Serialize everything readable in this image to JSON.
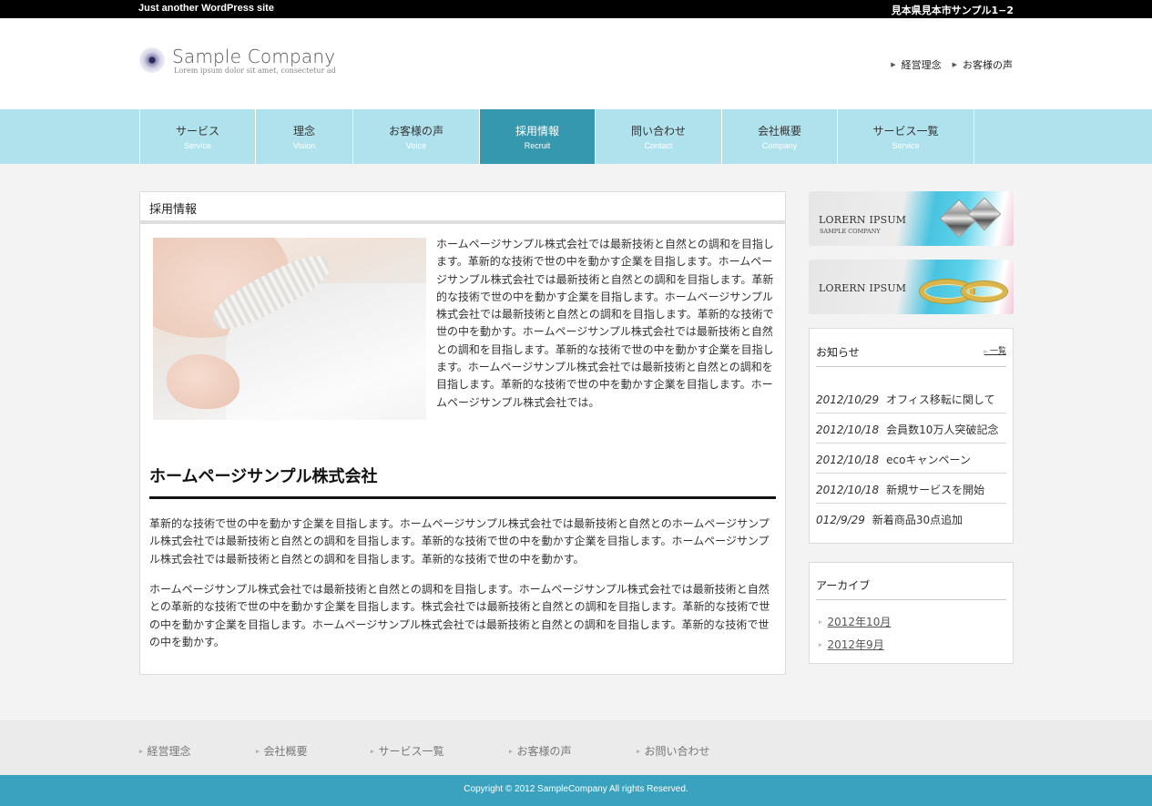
{
  "topbar": {
    "tagline": "Just another WordPress site",
    "address": "見本県見本市サンプル1−2"
  },
  "logo": {
    "name": "Sample Company",
    "sub": "Lorem ipsum dolor sit amet, consectetur ad"
  },
  "header_links": [
    {
      "label": "経営理念"
    },
    {
      "label": "お客様の声"
    }
  ],
  "nav": [
    {
      "jp": "サービス",
      "en": "Service",
      "active": false
    },
    {
      "jp": "理念",
      "en": "Vision",
      "active": false
    },
    {
      "jp": "お客様の声",
      "en": "Voice",
      "active": false
    },
    {
      "jp": "採用情報",
      "en": "Recruit",
      "active": true
    },
    {
      "jp": "問い合わせ",
      "en": "Contact",
      "active": false
    },
    {
      "jp": "会社概要",
      "en": "Company",
      "active": false
    },
    {
      "jp": "サービス一覧",
      "en": "Service",
      "active": false
    }
  ],
  "article": {
    "title": "採用情報",
    "intro": "ホームページサンプル株式会社では最新技術と自然との調和を目指します。革新的な技術で世の中を動かす企業を目指します。ホームページサンプル株式会社では最新技術と自然との調和を目指します。革新的な技術で世の中を動かす企業を目指します。ホームページサンプル株式会社では最新技術と自然との調和を目指します。革新的な技術で世の中を動かす。ホームページサンプル株式会社では最新技術と自然との調和を目指します。革新的な技術で世の中を動かす企業を目指します。ホームページサンプル株式会社では最新技術と自然との調和を目指します。革新的な技術で世の中を動かす企業を目指します。ホームページサンプル株式会社では。",
    "heading": "ホームページサンプル株式会社",
    "para1": "革新的な技術で世の中を動かす企業を目指します。ホームページサンプル株式会社では最新技術と自然とのホームページサンプル株式会社では最新技術と自然との調和を目指します。革新的な技術で世の中を動かす企業を目指します。ホームページサンプル株式会社では最新技術と自然との調和を目指します。革新的な技術で世の中を動かす。",
    "para2": "ホームページサンプル株式会社では最新技術と自然との調和を目指します。ホームページサンプル株式会社では最新技術と自然との革新的な技術で世の中を動かす企業を目指します。株式会社では最新技術と自然との調和を目指します。革新的な技術で世の中を動かす企業を目指します。ホームページサンプル株式会社では最新技術と自然との調和を目指します。革新的な技術で世の中を動かす。"
  },
  "banners": [
    {
      "title": "LORERN IPSUM",
      "sub": "SAMPLE COMPANY",
      "icon": "diamond-icon"
    },
    {
      "title": "LORERN IPSUM",
      "icon": "ring-icon"
    }
  ],
  "news": {
    "title": "お知らせ",
    "more": "一覧",
    "items": [
      {
        "date": "2012/10/29",
        "text": "オフィス移転に関して"
      },
      {
        "date": "2012/10/18",
        "text": "会員数10万人突破記念"
      },
      {
        "date": "2012/10/18",
        "text": "ecoキャンペーン"
      },
      {
        "date": "2012/10/18",
        "text": "新規サービスを開始"
      },
      {
        "date": "012/9/29",
        "text": "新着商品30点追加"
      }
    ]
  },
  "archive": {
    "title": "アーカイブ",
    "items": [
      {
        "label": "2012年10月"
      },
      {
        "label": "2012年9月"
      }
    ]
  },
  "footer_links": [
    {
      "label": "経営理念"
    },
    {
      "label": "会社概要"
    },
    {
      "label": "サービス一覧"
    },
    {
      "label": "お客様の声"
    },
    {
      "label": "お問い合わせ"
    }
  ],
  "copyright": "Copyright © 2012 SampleCompany All rights Reserved.",
  "colors": {
    "nav_bg": "#b0e2ee",
    "nav_active": "#3698ae",
    "copyright_bg": "#3aa2be"
  }
}
